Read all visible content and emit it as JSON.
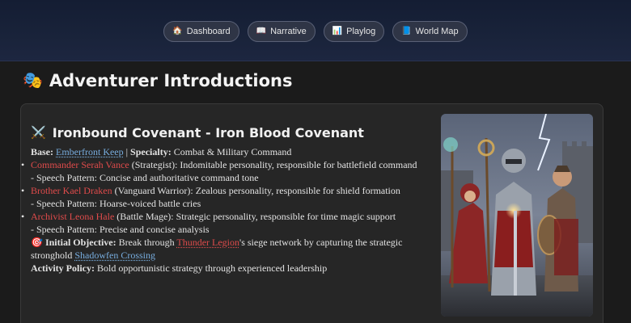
{
  "nav": {
    "items": [
      {
        "icon": "dashboard-icon",
        "glyph": "🏠",
        "label": "Dashboard"
      },
      {
        "icon": "book-icon",
        "glyph": "📖",
        "label": "Narrative"
      },
      {
        "icon": "chart-icon",
        "glyph": "📊",
        "label": "Playlog"
      },
      {
        "icon": "map-icon",
        "glyph": "📘",
        "label": "World Map"
      }
    ]
  },
  "page": {
    "title_glyph": "🎭",
    "title": "Adventurer Introductions"
  },
  "faction": {
    "glyph": "⚔️",
    "title": "Ironbound Covenant - Iron Blood Covenant",
    "base_label": "Base:",
    "base_value": "Emberfront Keep",
    "sep": " | ",
    "specialty_label": "Specialty:",
    "specialty_value": " Combat & Military Command",
    "members": [
      {
        "name": "Commander Serah Vance",
        "desc": " (Strategist): Indomitable personality, responsible for battlefield command",
        "speech": "- Speech Pattern: Concise and authoritative command tone"
      },
      {
        "name": "Brother Kael Draken",
        "desc": " (Vanguard Warrior): Zealous personality, responsible for shield formation",
        "speech": "- Speech Pattern: Hoarse-voiced battle cries"
      },
      {
        "name": "Archivist Leona Hale",
        "desc": " (Battle Mage): Strategic personality, responsible for time magic support",
        "speech": "- Speech Pattern: Precise and concise analysis"
      }
    ],
    "objective_glyph": "🎯",
    "objective_label": "Initial Objective:",
    "objective_pre": " Break through ",
    "objective_enemy": "Thunder Legion",
    "objective_mid": "'s siege network by capturing the strategic stronghold ",
    "objective_place": "Shadowfen Crossing",
    "policy_label": "Activity Policy:",
    "policy_value": " Bold opportunistic strategy through experienced leadership"
  },
  "colors": {
    "accent_red": "#e04b4b",
    "link_blue": "#78aee0"
  }
}
